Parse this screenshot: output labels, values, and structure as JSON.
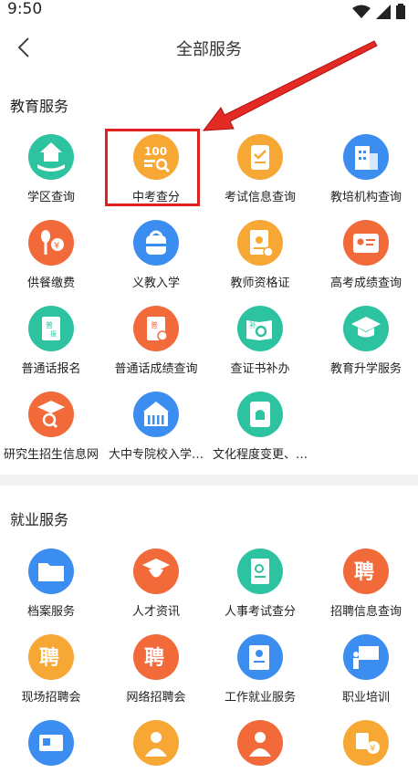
{
  "status": {
    "time": "9:50"
  },
  "nav": {
    "title": "全部服务"
  },
  "education": {
    "title": "教育服务",
    "items": [
      {
        "label": "学区查询",
        "color": "#2ec3a0",
        "icon": "house-hand-icon"
      },
      {
        "label": "中考查分",
        "color": "#f7a733",
        "icon": "score-100-icon"
      },
      {
        "label": "考试信息查询",
        "color": "#f7a733",
        "icon": "clipboard-check-icon"
      },
      {
        "label": "教培机构查询",
        "color": "#3b8ef0",
        "icon": "building-icon"
      },
      {
        "label": "供餐缴费",
        "color": "#f26a3a",
        "icon": "meal-payment-icon"
      },
      {
        "label": "义教入学",
        "color": "#3b8ef0",
        "icon": "school-bag-icon"
      },
      {
        "label": "教师资格证",
        "color": "#f7a733",
        "icon": "certificate-icon"
      },
      {
        "label": "高考成绩查询",
        "color": "#f26a3a",
        "icon": "id-card-icon"
      },
      {
        "label": "普通话报名",
        "color": "#2ec3a0",
        "icon": "book-register-icon"
      },
      {
        "label": "普通话成绩查询",
        "color": "#f26a3a",
        "icon": "book-score-icon"
      },
      {
        "label": "查证书补办",
        "color": "#2ec3a0",
        "icon": "book-search-icon"
      },
      {
        "label": "教育升学服务",
        "color": "#2ec3a0",
        "icon": "graduation-cap-icon"
      },
      {
        "label": "研究生招生信息网",
        "color": "#f26a3a",
        "icon": "graduate-search-icon"
      },
      {
        "label": "大中专院校入学…",
        "color": "#3b8ef0",
        "icon": "campus-icon"
      },
      {
        "label": "文化程度变更、…",
        "color": "#2ec3a0",
        "icon": "document-edit-icon"
      }
    ]
  },
  "employment": {
    "title": "就业服务",
    "items": [
      {
        "label": "档案服务",
        "color": "#3b8ef0",
        "icon": "folder-icon"
      },
      {
        "label": "人才资讯",
        "color": "#f26a3a",
        "icon": "talent-cap-icon"
      },
      {
        "label": "人事考试查分",
        "color": "#2ec3a0",
        "icon": "exam-score-icon"
      },
      {
        "label": "招聘信息查询",
        "color": "#f26a3a",
        "icon": "recruit-icon"
      },
      {
        "label": "现场招聘会",
        "color": "#f7a733",
        "icon": "recruit-icon"
      },
      {
        "label": "网络招聘会",
        "color": "#f26a3a",
        "icon": "recruit-icon"
      },
      {
        "label": "工作就业服务",
        "color": "#3b8ef0",
        "icon": "worker-card-icon"
      },
      {
        "label": "职业培训",
        "color": "#3b8ef0",
        "icon": "training-board-icon"
      },
      {
        "label": "",
        "color": "#3b8ef0",
        "icon": "screen-icon"
      },
      {
        "label": "",
        "color": "#f7a733",
        "icon": "person-icon"
      },
      {
        "label": "",
        "color": "#f26a3a",
        "icon": "person-icon"
      },
      {
        "label": "",
        "color": "#f7a733",
        "icon": "insurance-icon"
      }
    ]
  },
  "recruit_glyph": "聘"
}
